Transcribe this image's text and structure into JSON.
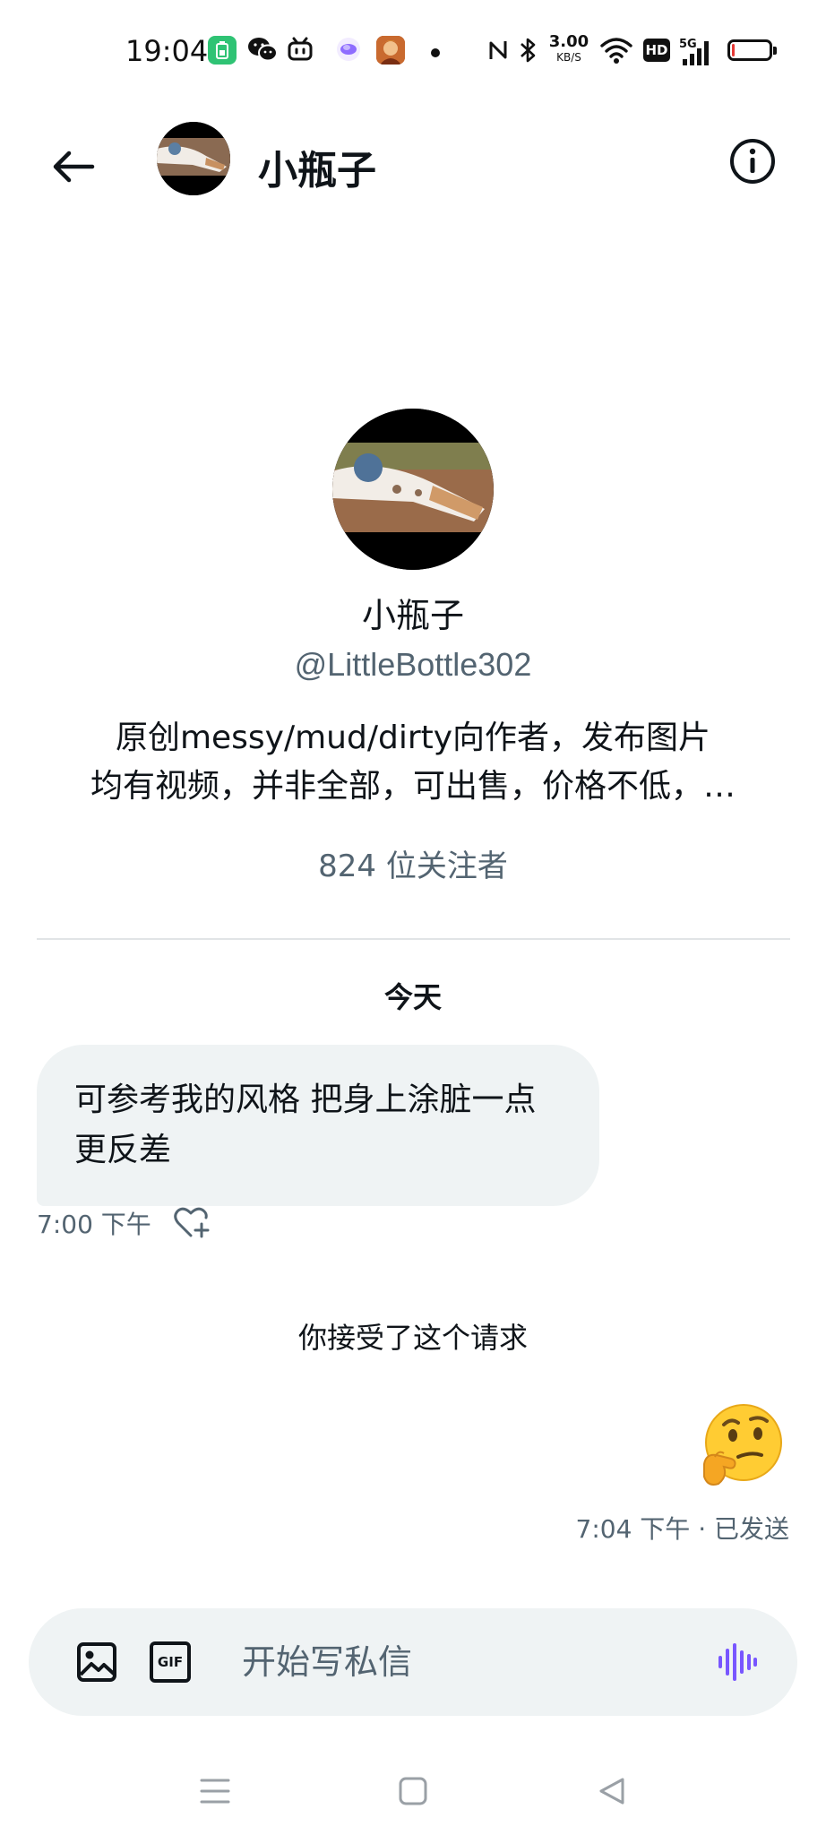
{
  "status_bar": {
    "time": "19:04",
    "net_speed_value": "3.00",
    "net_speed_unit": "KB/S",
    "network_type": "5G",
    "hd_label": "HD",
    "battery_level": 0.08,
    "icons": [
      "battery-saver-app-icon",
      "wechat-icon",
      "bilibili-icon",
      "app-icon",
      "game-icon",
      "dot-icon",
      "nfc-icon",
      "bluetooth-icon",
      "wifi-icon",
      "hd-icon",
      "signal-icon",
      "battery-icon"
    ]
  },
  "header": {
    "title": "小瓶子",
    "back_icon": "arrow-left-icon",
    "info_icon": "info-icon"
  },
  "profile": {
    "name": "小瓶子",
    "handle": "@LittleBottle302",
    "bio_line1": "原创messy/mud/dirty向作者，发布图片",
    "bio_line2": "均有视频，并非全部，可出售，价格不低，…",
    "followers": "824 位关注者"
  },
  "conversation": {
    "day_label": "今天",
    "received": {
      "line1": "可参考我的风格 把身上涂脏一点",
      "line2": "更反差",
      "time": "7:00 下午"
    },
    "system_note": "你接受了这个请求",
    "sent": {
      "emoji": "🤔",
      "meta": "7:04 下午 · 已发送"
    }
  },
  "composer": {
    "placeholder": "开始写私信",
    "gif_label": "GIF",
    "image_icon": "image-icon",
    "voice_icon": "voice-wave-icon"
  },
  "colors": {
    "text": "#0f1419",
    "secondary": "#536471",
    "bubble": "#eff3f4",
    "accent": "#7856ff"
  }
}
